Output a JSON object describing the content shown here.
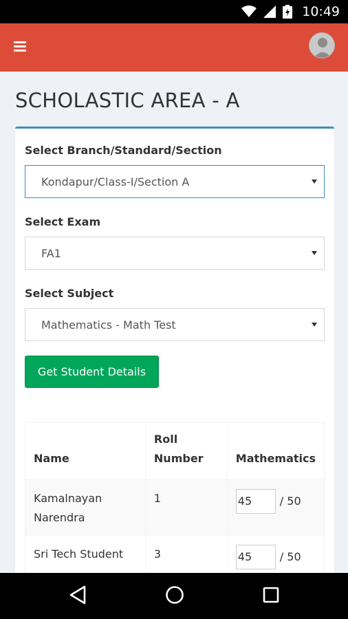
{
  "status_bar": {
    "time": "10:49"
  },
  "app_bar": {
    "menu_icon": "hamburger-icon",
    "avatar_icon": "user-avatar-icon",
    "color": "#dd4b39"
  },
  "page": {
    "title": "SCHOLASTIC AREA - A"
  },
  "form": {
    "branch_label": "Select Branch/Standard/Section",
    "branch_value": "Kondapur/Class-I/Section A",
    "exam_label": "Select Exam",
    "exam_value": "FA1",
    "subject_label": "Select Subject",
    "subject_value": "Mathematics - Math Test",
    "submit_label": "Get Student Details"
  },
  "table": {
    "headers": {
      "name": "Name",
      "roll_line1": "Roll",
      "roll_line2": "Number",
      "subject": "Mathematics"
    },
    "rows": [
      {
        "name": "Kamalnayan Narendra",
        "roll": "1",
        "mark": "45",
        "max": "/ 50"
      },
      {
        "name": "Sri Tech Student",
        "roll": "3",
        "mark": "45",
        "max": "/ 50"
      }
    ]
  },
  "colors": {
    "accent": "#3c8dbc",
    "success": "#00a65a",
    "header": "#dd4b39"
  }
}
